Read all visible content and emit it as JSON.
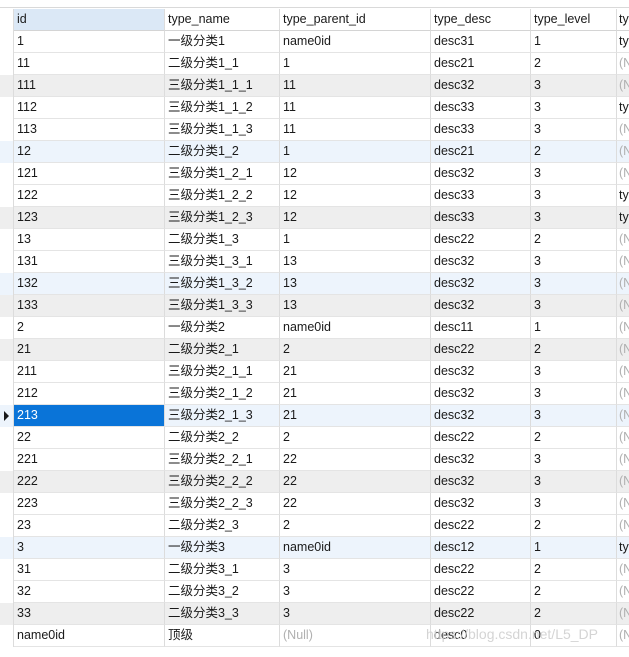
{
  "columns": [
    "id",
    "type_name",
    "type_parent_id",
    "type_desc",
    "type_level",
    "ty"
  ],
  "rows": [
    {
      "id": "1",
      "type_name": "一级分类1",
      "type_parent_id": "name0id",
      "type_desc": "desc31",
      "type_level": "1",
      "extra": "ty",
      "shade": "none"
    },
    {
      "id": "11",
      "type_name": "二级分类1_1",
      "type_parent_id": "1",
      "type_desc": "desc21",
      "type_level": "2",
      "extra": "(N",
      "shade": "none"
    },
    {
      "id": "111",
      "type_name": "三级分类1_1_1",
      "type_parent_id": "11",
      "type_desc": "desc32",
      "type_level": "3",
      "extra": "(N",
      "shade": "alt"
    },
    {
      "id": "112",
      "type_name": "三级分类1_1_2",
      "type_parent_id": "11",
      "type_desc": "desc33",
      "type_level": "3",
      "extra": "ty",
      "shade": "none"
    },
    {
      "id": "113",
      "type_name": "三级分类1_1_3",
      "type_parent_id": "11",
      "type_desc": "desc33",
      "type_level": "3",
      "extra": "(N",
      "shade": "none"
    },
    {
      "id": "12",
      "type_name": "二级分类1_2",
      "type_parent_id": "1",
      "type_desc": "desc21",
      "type_level": "2",
      "extra": "(N",
      "shade": "hl"
    },
    {
      "id": "121",
      "type_name": "三级分类1_2_1",
      "type_parent_id": "12",
      "type_desc": "desc32",
      "type_level": "3",
      "extra": "(N",
      "shade": "none"
    },
    {
      "id": "122",
      "type_name": "三级分类1_2_2",
      "type_parent_id": "12",
      "type_desc": "desc33",
      "type_level": "3",
      "extra": "ty",
      "shade": "none"
    },
    {
      "id": "123",
      "type_name": "三级分类1_2_3",
      "type_parent_id": "12",
      "type_desc": "desc33",
      "type_level": "3",
      "extra": "ty",
      "shade": "alt"
    },
    {
      "id": "13",
      "type_name": "二级分类1_3",
      "type_parent_id": "1",
      "type_desc": "desc22",
      "type_level": "2",
      "extra": "(N",
      "shade": "none"
    },
    {
      "id": "131",
      "type_name": "三级分类1_3_1",
      "type_parent_id": "13",
      "type_desc": "desc32",
      "type_level": "3",
      "extra": "(N",
      "shade": "none"
    },
    {
      "id": "132",
      "type_name": "三级分类1_3_2",
      "type_parent_id": "13",
      "type_desc": "desc32",
      "type_level": "3",
      "extra": "(N",
      "shade": "hl"
    },
    {
      "id": "133",
      "type_name": "三级分类1_3_3",
      "type_parent_id": "13",
      "type_desc": "desc32",
      "type_level": "3",
      "extra": "(N",
      "shade": "alt"
    },
    {
      "id": "2",
      "type_name": "一级分类2",
      "type_parent_id": "name0id",
      "type_desc": "desc11",
      "type_level": "1",
      "extra": "(N",
      "shade": "none"
    },
    {
      "id": "21",
      "type_name": "二级分类2_1",
      "type_parent_id": "2",
      "type_desc": "desc22",
      "type_level": "2",
      "extra": "(N",
      "shade": "alt"
    },
    {
      "id": "211",
      "type_name": "三级分类2_1_1",
      "type_parent_id": "21",
      "type_desc": "desc32",
      "type_level": "3",
      "extra": "(N",
      "shade": "none"
    },
    {
      "id": "212",
      "type_name": "三级分类2_1_2",
      "type_parent_id": "21",
      "type_desc": "desc32",
      "type_level": "3",
      "extra": "(N",
      "shade": "none"
    },
    {
      "id": "213",
      "type_name": "三级分类2_1_3",
      "type_parent_id": "21",
      "type_desc": "desc32",
      "type_level": "3",
      "extra": "(N",
      "shade": "hl",
      "selected": true
    },
    {
      "id": "22",
      "type_name": "二级分类2_2",
      "type_parent_id": "2",
      "type_desc": "desc22",
      "type_level": "2",
      "extra": "(N",
      "shade": "none"
    },
    {
      "id": "221",
      "type_name": "三级分类2_2_1",
      "type_parent_id": "22",
      "type_desc": "desc32",
      "type_level": "3",
      "extra": "(N",
      "shade": "none"
    },
    {
      "id": "222",
      "type_name": "三级分类2_2_2",
      "type_parent_id": "22",
      "type_desc": "desc32",
      "type_level": "3",
      "extra": "(N",
      "shade": "alt"
    },
    {
      "id": "223",
      "type_name": "三级分类2_2_3",
      "type_parent_id": "22",
      "type_desc": "desc32",
      "type_level": "3",
      "extra": "(N",
      "shade": "none"
    },
    {
      "id": "23",
      "type_name": "二级分类2_3",
      "type_parent_id": "2",
      "type_desc": "desc22",
      "type_level": "2",
      "extra": "(N",
      "shade": "none"
    },
    {
      "id": "3",
      "type_name": "一级分类3",
      "type_parent_id": "name0id",
      "type_desc": "desc12",
      "type_level": "1",
      "extra": "ty",
      "shade": "hl"
    },
    {
      "id": "31",
      "type_name": "二级分类3_1",
      "type_parent_id": "3",
      "type_desc": "desc22",
      "type_level": "2",
      "extra": "(N",
      "shade": "none"
    },
    {
      "id": "32",
      "type_name": "二级分类3_2",
      "type_parent_id": "3",
      "type_desc": "desc22",
      "type_level": "2",
      "extra": "(N",
      "shade": "none"
    },
    {
      "id": "33",
      "type_name": "二级分类3_3",
      "type_parent_id": "3",
      "type_desc": "desc22",
      "type_level": "2",
      "extra": "(N",
      "shade": "alt"
    },
    {
      "id": "name0id",
      "type_name": "顶级",
      "type_parent_id": "(Null)",
      "type_desc": "desc0",
      "type_level": "0",
      "extra": "(N",
      "shade": "none"
    }
  ],
  "watermark": "https://blog.csdn.net/L5_DP"
}
